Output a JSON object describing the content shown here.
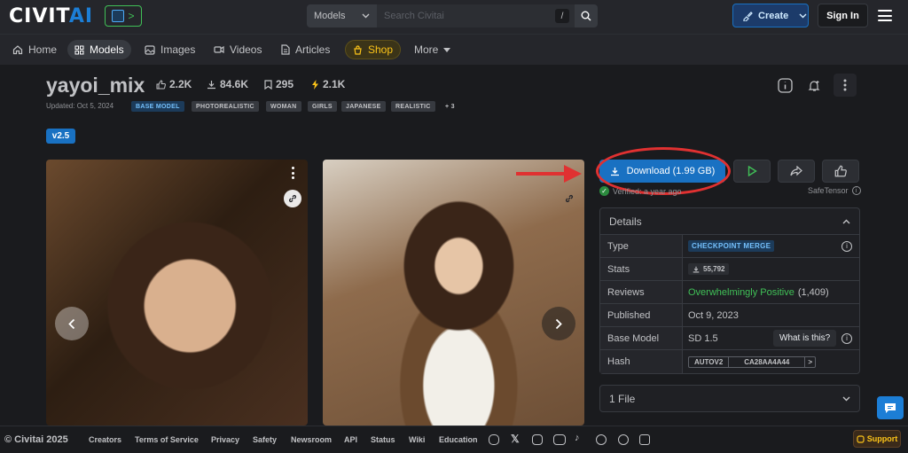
{
  "header": {
    "logo_main": "CIVIT",
    "logo_ai": "AI",
    "logo_badge_arrow": ">",
    "search_scope": "Models",
    "search_placeholder": "Search Civitai",
    "search_shortcut": "/",
    "create_label": "Create",
    "signin_label": "Sign In"
  },
  "nav": [
    {
      "label": "Home",
      "icon": "home-icon"
    },
    {
      "label": "Models",
      "icon": "grid-icon"
    },
    {
      "label": "Images",
      "icon": "image-icon"
    },
    {
      "label": "Videos",
      "icon": "video-icon"
    },
    {
      "label": "Articles",
      "icon": "article-icon"
    },
    {
      "label": "Shop",
      "icon": "shop-icon"
    },
    {
      "label": "More",
      "icon": "caret-down-icon"
    }
  ],
  "model": {
    "title": "yayoi_mix",
    "likes": "2.2K",
    "downloads": "84.6K",
    "bookmarks": "295",
    "buzz": "2.1K",
    "updated": "Updated: Oct 5, 2024",
    "tags": [
      "BASE MODEL",
      "PHOTOREALISTIC",
      "WOMAN",
      "GIRLS",
      "JAPANESE",
      "REALISTIC",
      "+ 3"
    ],
    "version": "v2.5"
  },
  "actions": {
    "download_label": "Download (1.99 GB)",
    "verified": "Verified: a year ago",
    "format": "SafeTensor"
  },
  "details": {
    "heading": "Details",
    "type_key": "Type",
    "type_val": "CHECKPOINT MERGE",
    "stats_key": "Stats",
    "stats_val": "55,792",
    "reviews_key": "Reviews",
    "reviews_val": "Overwhelmingly Positive",
    "reviews_count": "(1,409)",
    "published_key": "Published",
    "published_val": "Oct 9, 2023",
    "base_key": "Base Model",
    "base_val": "SD 1.5",
    "base_tooltip": "What is this?",
    "hash_key": "Hash",
    "hash_algo": "AUTOV2",
    "hash_val": "CA28AA4A44",
    "hash_next": ">"
  },
  "files": {
    "label": "1 File"
  },
  "footer": {
    "copyright": "© Civitai 2025",
    "links": [
      "Creators",
      "Terms of Service",
      "Privacy",
      "Safety",
      "Newsroom",
      "API",
      "Status",
      "Wiki",
      "Education"
    ],
    "support": "Support"
  },
  "colors": {
    "accent": "#1971c2",
    "annotation_red": "#e03131",
    "positive_green": "#40c057",
    "shop_yellow": "#fcc419"
  }
}
